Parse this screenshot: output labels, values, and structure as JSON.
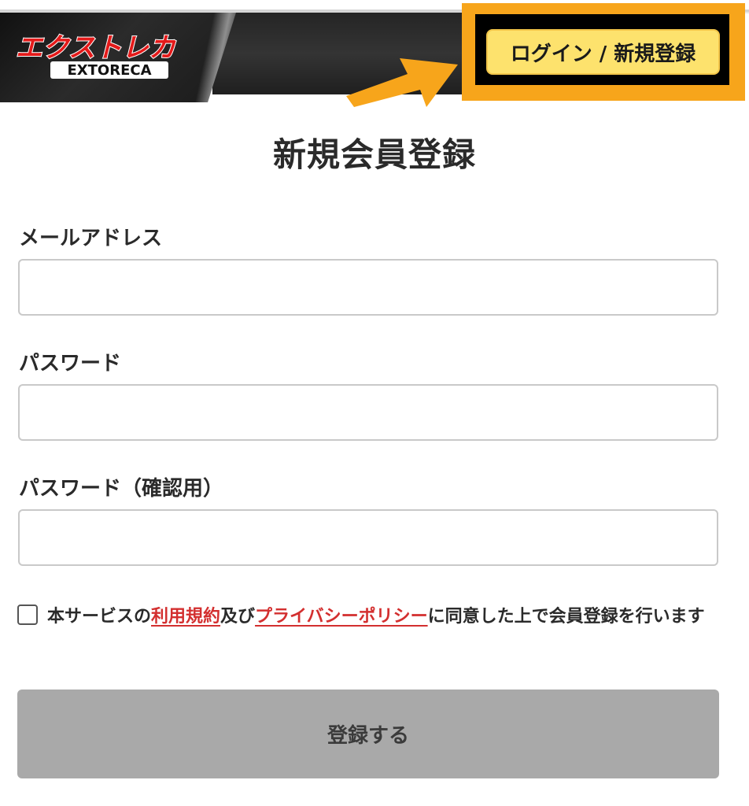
{
  "header": {
    "logo_text_jp": "エクストレカ",
    "logo_text_en": "EXTORECA",
    "login_button_label": "ログイン / 新規登録",
    "highlight_color": "#f7a51b"
  },
  "page": {
    "title": "新規会員登録"
  },
  "form": {
    "email_label": "メールアドレス",
    "email_value": "",
    "password_label": "パスワード",
    "password_value": "",
    "password_confirm_label": "パスワード（確認用）",
    "password_confirm_value": ""
  },
  "agreement": {
    "prefix": "本サービスの",
    "terms_link": "利用規約",
    "middle": "及び",
    "privacy_link": "プライバシーポリシー",
    "suffix": "に同意した上で会員登録を行います",
    "checked": false
  },
  "submit": {
    "label": "登録する",
    "state": "disabled"
  }
}
